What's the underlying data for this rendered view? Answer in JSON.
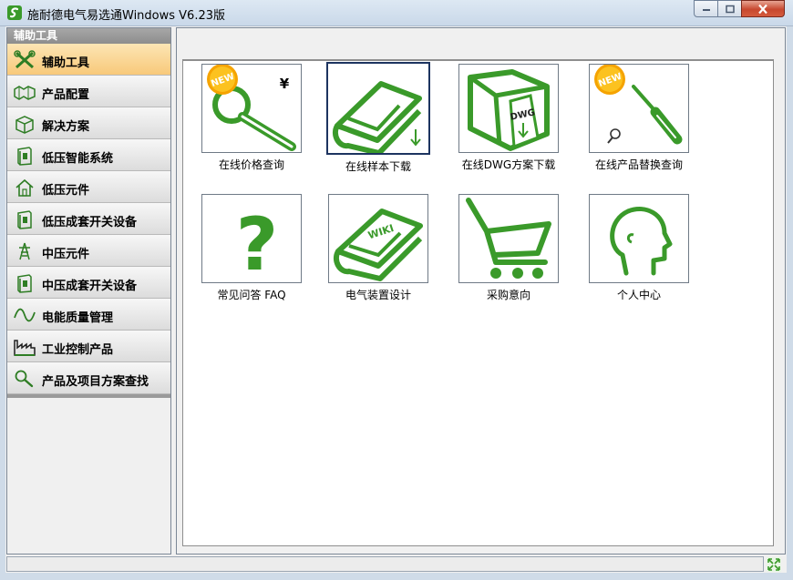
{
  "window": {
    "title": "施耐德电气易选通Windows V6.23版",
    "icons": {
      "app": "schneider-logo-icon",
      "minimize": "minimize-icon",
      "maximize": "maximize-icon",
      "close": "close-icon"
    }
  },
  "sidebar": {
    "header": "辅助工具",
    "items": [
      {
        "label": "辅助工具",
        "icon": "tools-icon",
        "active": true
      },
      {
        "label": "产品配置",
        "icon": "configure-icon"
      },
      {
        "label": "解决方案",
        "icon": "box-icon"
      },
      {
        "label": "低压智能系统",
        "icon": "cabinet-icon"
      },
      {
        "label": "低压元件",
        "icon": "home-icon"
      },
      {
        "label": "低压成套开关设备",
        "icon": "cabinet-icon"
      },
      {
        "label": "中压元件",
        "icon": "tower-icon"
      },
      {
        "label": "中压成套开关设备",
        "icon": "cabinet-icon"
      },
      {
        "label": "电能质量管理",
        "icon": "wave-icon"
      },
      {
        "label": "工业控制产品",
        "icon": "factory-icon"
      },
      {
        "label": "产品及项目方案查找",
        "icon": "search-icon"
      }
    ]
  },
  "tools": [
    {
      "label": "在线价格查询",
      "icon": "price-search-icon",
      "badge": "NEW",
      "symbol": "¥"
    },
    {
      "label": "在线样本下载",
      "icon": "catalog-download-icon",
      "selected": true
    },
    {
      "label": "在线DWG方案下载",
      "icon": "dwg-download-icon",
      "tag": "DWG"
    },
    {
      "label": "在线产品替换查询",
      "icon": "replace-search-icon",
      "badge": "NEW"
    },
    {
      "label": "常见问答 FAQ",
      "icon": "faq-icon",
      "symbol": "?"
    },
    {
      "label": "电气装置设计",
      "icon": "wiki-book-icon",
      "tag": "WIKI"
    },
    {
      "label": "采购意向",
      "icon": "cart-icon"
    },
    {
      "label": "个人中心",
      "icon": "person-icon"
    }
  ],
  "colors": {
    "green": "#3a9a2a",
    "title_bar": "#c9d8e9",
    "active_nav": "#f8c97a",
    "badge": "#f5a300"
  }
}
